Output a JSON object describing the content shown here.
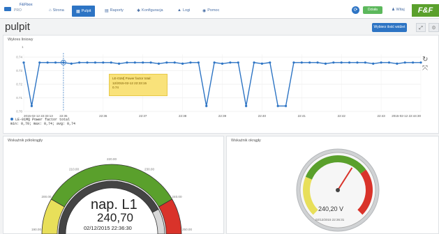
{
  "nav": {
    "logo_line1": "F&Fbox",
    "logo_line2": "PRO",
    "items": [
      {
        "label": "Strona",
        "icon": "home-icon",
        "active": false
      },
      {
        "label": "Pulpit",
        "icon": "dashboard-icon",
        "active": true
      },
      {
        "label": "Raporty",
        "icon": "reports-icon",
        "active": false
      },
      {
        "label": "Konfiguracja",
        "icon": "settings-icon",
        "active": false
      },
      {
        "label": "Logi",
        "icon": "warning-icon",
        "active": false
      },
      {
        "label": "Pomoc",
        "icon": "help-icon",
        "active": false
      }
    ],
    "status_badge": "Działa",
    "user_label": "Witaj",
    "brand": "F&F"
  },
  "page": {
    "title": "pulpit",
    "select_button": "Wybierz ilość widżet",
    "expand_label": "⤢",
    "gear_label": "⚙"
  },
  "line_panel": {
    "title": "Wykres liniowy",
    "y_axis_top": "1",
    "tooltip_line1": "LE-01M[ Power factor total:",
    "tooltip_line2": "12/2015-02-12 22:33:15",
    "tooltip_line3": "0.74",
    "legend_line1": "LE-01MQ Power factor total",
    "legend_line2": "min: 0,70; max: 0,74; avg: 0,74",
    "x_first": "2015-02-12 22:33:13",
    "x_last": "2015-02-12 22:44:30"
  },
  "chart_data": {
    "type": "line",
    "title": "",
    "xlabel": "",
    "ylabel": "",
    "x_ticks": [
      "2015-02-12 22:33:13",
      "22:35",
      "22:36",
      "22:37",
      "22:38",
      "22:39",
      "22:40",
      "22:41",
      "22:42",
      "22:43",
      "2015-02-12 22:44:30"
    ],
    "y_ticks": [
      "0.74",
      "0.73",
      "0.72",
      "0.71",
      "0.70"
    ],
    "ylim": [
      0.695,
      0.745
    ],
    "series": [
      {
        "name": "LE-01MQ Power factor total",
        "values": [
          0.74,
          0.7,
          0.74,
          0.74,
          0.74,
          0.74,
          0.739,
          0.74,
          0.74,
          0.74,
          0.74,
          0.74,
          0.739,
          0.74,
          0.74,
          0.74,
          0.74,
          0.739,
          0.74,
          0.74,
          0.739,
          0.74,
          0.74,
          0.7,
          0.74,
          0.739,
          0.74,
          0.74,
          0.7,
          0.74,
          0.739,
          0.74,
          0.7,
          0.7,
          0.74,
          0.74,
          0.74,
          0.74,
          0.739,
          0.74,
          0.74,
          0.74,
          0.74,
          0.74,
          0.739,
          0.74,
          0.74,
          0.739,
          0.74,
          0.74,
          0.74
        ]
      }
    ],
    "color": "#2d74c4",
    "grid": true
  },
  "gauge1": {
    "title": "Wskaźnik półokrągły",
    "label": "nap. L1",
    "value": "240,70",
    "date": "02/12/2015 22:36:30",
    "ticks": [
      "190.00",
      "200.00",
      "210.00",
      "220.00",
      "230.00",
      "240.00",
      "250.00"
    ],
    "min": 190,
    "max": 250,
    "reading": 240.7
  },
  "gauge2": {
    "title": "Wskaźnik okrągły",
    "value": "240,20 V",
    "date": "02/12/2015 22:36:31",
    "reading_fraction": 0.62
  },
  "colors": {
    "accent": "#2d74c4",
    "green": "#5aa02c",
    "yellow": "#e8df5a",
    "red": "#d9332a"
  }
}
